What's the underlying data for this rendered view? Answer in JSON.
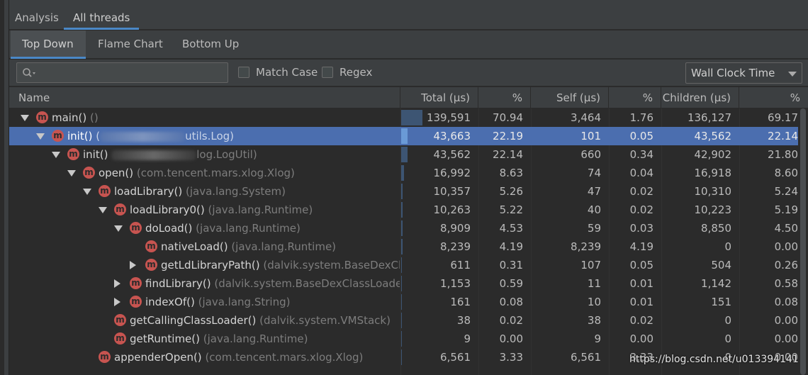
{
  "tabs_top": [
    {
      "label": "Analysis",
      "active": false
    },
    {
      "label": "All threads",
      "active": true
    }
  ],
  "tabs_view": [
    {
      "label": "Top Down",
      "active": true
    },
    {
      "label": "Flame Chart",
      "active": false
    },
    {
      "label": "Bottom Up",
      "active": false
    }
  ],
  "toolbar": {
    "search_value": "",
    "match_case_label": "Match Case",
    "match_case_checked": false,
    "regex_label": "Regex",
    "regex_checked": false,
    "clock_select": "Wall Clock Time"
  },
  "columns": [
    "Name",
    "Total (µs)",
    "%",
    "Self (µs)",
    "%",
    "Children (µs)",
    "%"
  ],
  "rows": [
    {
      "method": "main()",
      "cls": "()",
      "expander": "down",
      "total": "139,591",
      "total_pct": "70.94",
      "self": "3,464",
      "self_pct": "1.76",
      "children": "136,127",
      "children_pct": "69.17",
      "total_fraction": 0.7094
    },
    {
      "method": "init()",
      "cls": "(",
      "cls_tail": "utils.Log)",
      "redacted": true,
      "expander": "down",
      "selected": true,
      "total": "43,663",
      "total_pct": "22.19",
      "self": "101",
      "self_pct": "0.05",
      "children": "43,562",
      "children_pct": "22.14",
      "total_fraction": 0.2219
    },
    {
      "method": "init()",
      "cls": "",
      "cls_tail": "log.LogUtil)",
      "redacted": true,
      "expander": "down",
      "total": "43,562",
      "total_pct": "22.14",
      "self": "660",
      "self_pct": "0.34",
      "children": "42,902",
      "children_pct": "21.80",
      "total_fraction": 0.2214
    },
    {
      "method": "open()",
      "cls": "(com.tencent.mars.xlog.Xlog)",
      "expander": "down",
      "total": "16,992",
      "total_pct": "8.63",
      "self": "74",
      "self_pct": "0.04",
      "children": "16,918",
      "children_pct": "8.60",
      "total_fraction": 0.0863
    },
    {
      "method": "loadLibrary()",
      "cls": "(java.lang.System)",
      "expander": "down",
      "total": "10,357",
      "total_pct": "5.26",
      "self": "47",
      "self_pct": "0.02",
      "children": "10,310",
      "children_pct": "5.24",
      "total_fraction": 0.0526
    },
    {
      "method": "loadLibrary0()",
      "cls": "(java.lang.Runtime)",
      "expander": "down",
      "total": "10,263",
      "total_pct": "5.22",
      "self": "40",
      "self_pct": "0.02",
      "children": "10,223",
      "children_pct": "5.19",
      "total_fraction": 0.0522
    },
    {
      "method": "doLoad()",
      "cls": "(java.lang.Runtime)",
      "expander": "down",
      "total": "8,909",
      "total_pct": "4.53",
      "self": "59",
      "self_pct": "0.03",
      "children": "8,850",
      "children_pct": "4.50",
      "total_fraction": 0.0453
    },
    {
      "method": "nativeLoad()",
      "cls": "(java.lang.Runtime)",
      "expander": "none",
      "total": "8,239",
      "total_pct": "4.19",
      "self": "8,239",
      "self_pct": "4.19",
      "children": "0",
      "children_pct": "0.00",
      "total_fraction": 0.0419
    },
    {
      "method": "getLdLibraryPath()",
      "cls": "(dalvik.system.BaseDexClas",
      "expander": "right",
      "total": "611",
      "total_pct": "0.31",
      "self": "107",
      "self_pct": "0.05",
      "children": "504",
      "children_pct": "0.26",
      "total_fraction": 0.0031
    },
    {
      "method": "findLibrary()",
      "cls": "(dalvik.system.BaseDexClassLoader)",
      "expander": "right",
      "total": "1,153",
      "total_pct": "0.59",
      "self": "11",
      "self_pct": "0.01",
      "children": "1,142",
      "children_pct": "0.58",
      "total_fraction": 0.0059
    },
    {
      "method": "indexOf()",
      "cls": "(java.lang.String)",
      "expander": "right",
      "total": "161",
      "total_pct": "0.08",
      "self": "10",
      "self_pct": "0.01",
      "children": "151",
      "children_pct": "0.08",
      "total_fraction": 0.0008
    },
    {
      "method": "getCallingClassLoader()",
      "cls": "(dalvik.system.VMStack)",
      "expander": "none",
      "total": "38",
      "total_pct": "0.02",
      "self": "38",
      "self_pct": "0.02",
      "children": "0",
      "children_pct": "0.00",
      "total_fraction": 0.0002
    },
    {
      "method": "getRuntime()",
      "cls": "(java.lang.Runtime)",
      "expander": "none",
      "total": "9",
      "total_pct": "0.00",
      "self": "9",
      "self_pct": "0.00",
      "children": "0",
      "children_pct": "0.00",
      "total_fraction": 0.0
    },
    {
      "method": "appenderOpen()",
      "cls": "(com.tencent.mars.xlog.Xlog)",
      "expander": "none",
      "total": "6,561",
      "total_pct": "3.33",
      "self": "6,561",
      "self_pct": "3.33",
      "children": "0",
      "children_pct": "0.00",
      "total_fraction": 0.0333
    }
  ],
  "watermark": "https://blog.csdn.net/u013394141",
  "colors": {
    "selection": "#4b6eaf",
    "method_icon": "#c75450",
    "accent": "#4a88c7"
  },
  "icons": {
    "method": "m"
  }
}
